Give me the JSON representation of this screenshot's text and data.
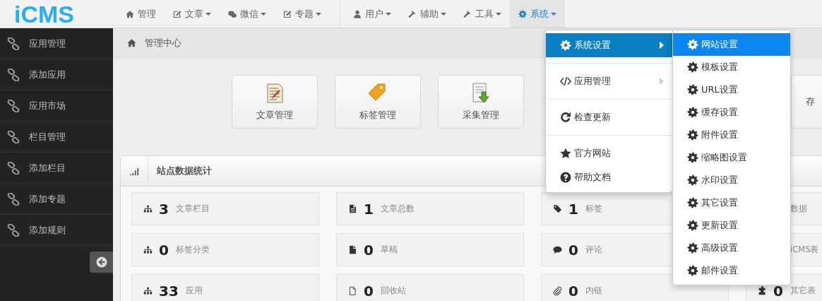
{
  "logo": "**i**CMS",
  "nav_groups": [
    [
      {
        "label": "管理",
        "dropdown": false,
        "selected": false
      },
      {
        "label": "文章",
        "dropdown": true,
        "selected": false
      },
      {
        "label": "微信",
        "dropdown": true,
        "selected": false
      },
      {
        "label": "专题",
        "dropdown": true,
        "selected": false
      }
    ],
    [
      {
        "label": "用户",
        "dropdown": true,
        "selected": false
      },
      {
        "label": "辅助",
        "dropdown": true,
        "selected": false
      },
      {
        "label": "工具",
        "dropdown": true,
        "selected": false
      },
      {
        "label": "系统",
        "dropdown": true,
        "selected": true
      }
    ]
  ],
  "sidebar": {
    "items": [
      "应用管理",
      "添加应用",
      "应用市场",
      "栏目管理",
      "添加栏目",
      "添加专题",
      "添加规则"
    ]
  },
  "breadcrumb": "管理中心",
  "quick_links": [
    {
      "label": "文章管理"
    },
    {
      "label": "标签管理"
    },
    {
      "label": "采集管理"
    },
    {
      "label": "存"
    }
  ],
  "stats_panel": {
    "title": "站点数据统计",
    "columns": [
      [
        {
          "number": "3",
          "label": "文章栏目"
        },
        {
          "number": "0",
          "label": "标签分类"
        },
        {
          "number": "33",
          "label": "应用"
        }
      ],
      [
        {
          "number": "1",
          "label": "文章总数"
        },
        {
          "number": "0",
          "label": "草稿"
        },
        {
          "number": "0",
          "label": "回收站"
        }
      ],
      [
        {
          "number": "1",
          "label": "标签"
        },
        {
          "number": "0",
          "label": "评论"
        },
        {
          "number": "0",
          "label": "内链"
        }
      ],
      [
        {
          "label": "数据"
        },
        {
          "label": "iCMS表"
        },
        {
          "number": "0",
          "label": "其它表"
        }
      ]
    ]
  },
  "system_menu": [
    {
      "kind": "item",
      "label": "系统设置",
      "selected": true,
      "submenu": true
    },
    {
      "kind": "divider"
    },
    {
      "kind": "item",
      "label": "应用管理",
      "selected": false,
      "submenu": true
    },
    {
      "kind": "divider"
    },
    {
      "kind": "item",
      "label": "检查更新",
      "selected": false,
      "submenu": false
    },
    {
      "kind": "divider"
    },
    {
      "kind": "item",
      "label": "官方网站",
      "selected": false,
      "submenu": false
    },
    {
      "kind": "item",
      "label": "帮助文档",
      "selected": false,
      "submenu": false
    }
  ],
  "settings_submenu": [
    {
      "label": "网站设置",
      "selected": true
    },
    {
      "label": "模板设置",
      "selected": false
    },
    {
      "label": "URL设置",
      "selected": false
    },
    {
      "label": "缓存设置",
      "selected": false
    },
    {
      "label": "附件设置",
      "selected": false
    },
    {
      "label": "缩略图设置",
      "selected": false
    },
    {
      "label": "水印设置",
      "selected": false
    },
    {
      "label": "其它设置",
      "selected": false
    },
    {
      "label": "更新设置",
      "selected": false
    },
    {
      "label": "高级设置",
      "selected": false
    },
    {
      "label": "邮件设置",
      "selected": false
    }
  ]
}
